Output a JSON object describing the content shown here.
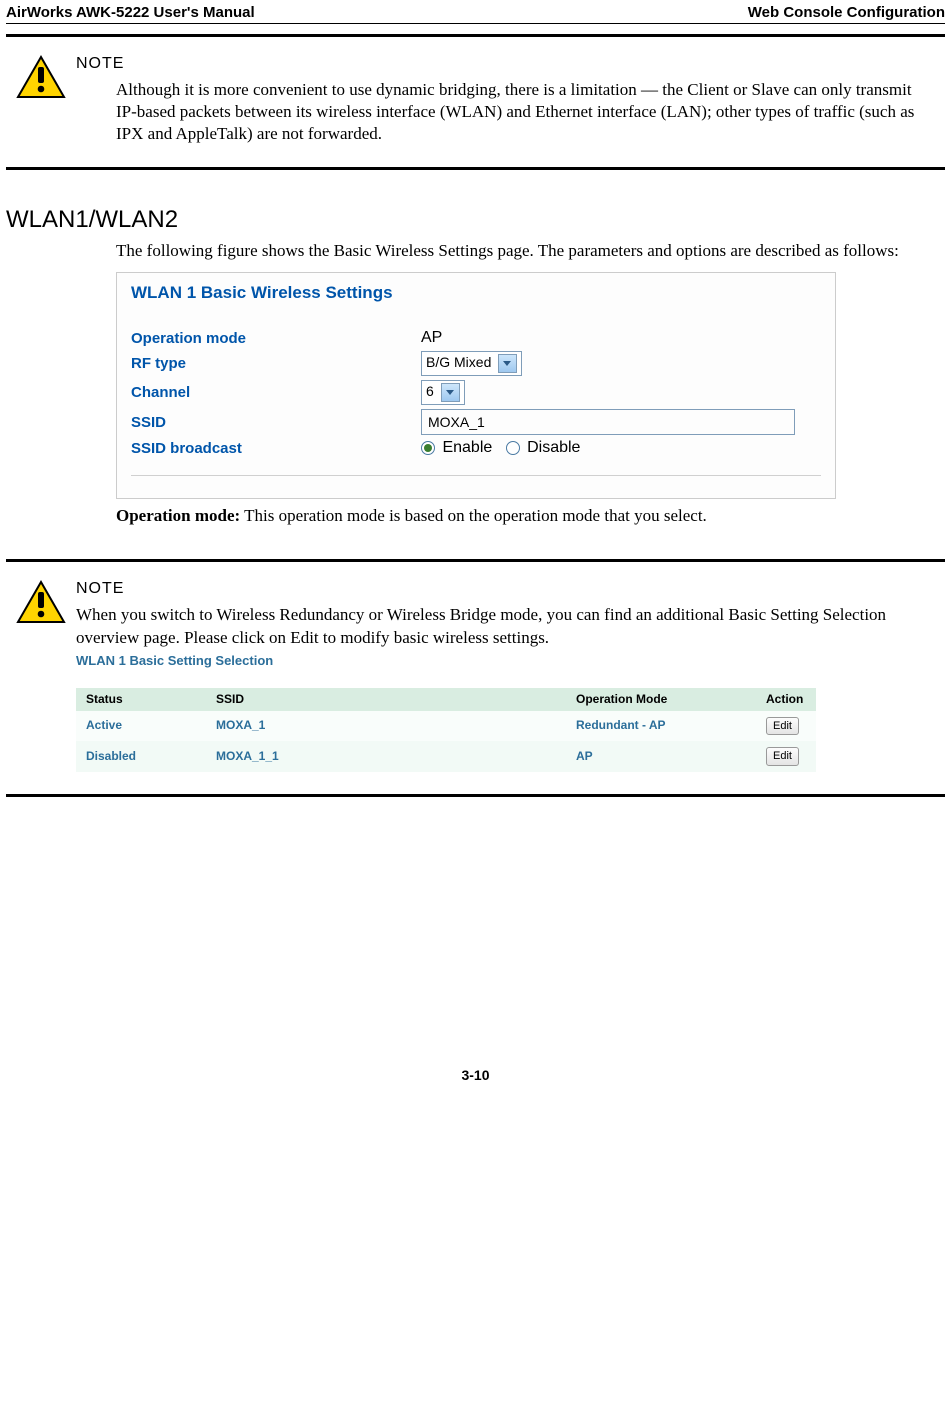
{
  "header": {
    "left": "AirWorks AWK-5222 User's Manual",
    "right": "Web Console Configuration"
  },
  "note1": {
    "title": "NOTE",
    "body": "Although it is more convenient to use dynamic bridging, there is a limitation — the Client or Slave can only transmit IP-based packets between its wireless interface (WLAN) and Ethernet interface (LAN); other types of traffic (such as IPX and AppleTalk) are not forwarded."
  },
  "section_heading": "WLAN1/WLAN2",
  "intro_text": "The following figure shows the Basic Wireless Settings page. The parameters and options are described as follows:",
  "screenshot1": {
    "title": "WLAN 1  Basic Wireless Settings",
    "rows": {
      "op_label": "Operation mode",
      "op_value": "AP",
      "rf_label": "RF type",
      "rf_value": "B/G Mixed",
      "ch_label": "Channel",
      "ch_value": "6",
      "ssid_label": "SSID",
      "ssid_value": "MOXA_1",
      "bcast_label": "SSID broadcast",
      "bcast_enable": "Enable",
      "bcast_disable": "Disable"
    }
  },
  "op_caption_bold": "Operation mode:",
  "op_caption_rest": " This operation mode is based on the operation mode that you select.",
  "note2": {
    "title": "NOTE",
    "body": "When you switch to Wireless Redundancy or Wireless Bridge mode, you can find an additional Basic Setting Selection overview page. Please click on Edit to modify basic wireless settings.",
    "sh_title": "WLAN 1 Basic Setting Selection",
    "headers": {
      "h1": "Status",
      "h2": "SSID",
      "h3": "Operation Mode",
      "h4": "Action"
    },
    "rows": [
      {
        "status": "Active",
        "ssid": "MOXA_1",
        "mode": "Redundant - AP",
        "action": "Edit"
      },
      {
        "status": "Disabled",
        "ssid": "MOXA_1_1",
        "mode": "AP",
        "action": "Edit"
      }
    ]
  },
  "page_num": "3-10"
}
